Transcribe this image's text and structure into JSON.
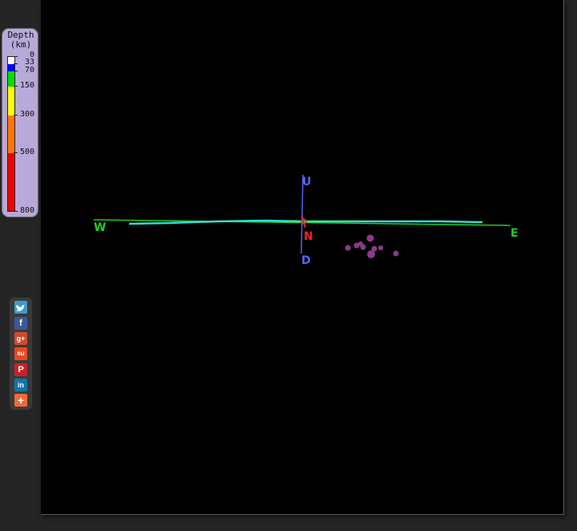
{
  "legend": {
    "title_line1": "Depth",
    "title_line2": "(km)",
    "ticks": [
      "0",
      "33",
      "70",
      "150",
      "300",
      "500",
      "800"
    ],
    "colors": {
      "d0_33": "#ffffff",
      "d33_70": "#0000ff",
      "d70_150": "#00dd00",
      "d150_300": "#ffff00",
      "d300_500": "#ff7700",
      "d500_800": "#ee0000"
    }
  },
  "viewport": {
    "background": "#000000",
    "axes": {
      "west": "W",
      "east": "E",
      "up": "U",
      "down": "D",
      "north": "N"
    },
    "axis_colors": {
      "ew": "#22cc22",
      "ud": "#5566ee",
      "north": "#ee2222",
      "profile": "#33ddcc",
      "events": "#8b3a8b"
    }
  },
  "share": {
    "buttons": [
      {
        "name": "twitter",
        "glyph": "t",
        "color": "#3a9ad0"
      },
      {
        "name": "facebook",
        "glyph": "f",
        "color": "#3b5998"
      },
      {
        "name": "google-plus",
        "glyph": "g+",
        "color": "#d3492c"
      },
      {
        "name": "stumbleupon",
        "glyph": "su",
        "color": "#eb4823"
      },
      {
        "name": "pinterest",
        "glyph": "P",
        "color": "#cb2027"
      },
      {
        "name": "linkedin",
        "glyph": "in",
        "color": "#0e76a8"
      },
      {
        "name": "more",
        "glyph": "+",
        "color": "#f06a35"
      }
    ]
  }
}
